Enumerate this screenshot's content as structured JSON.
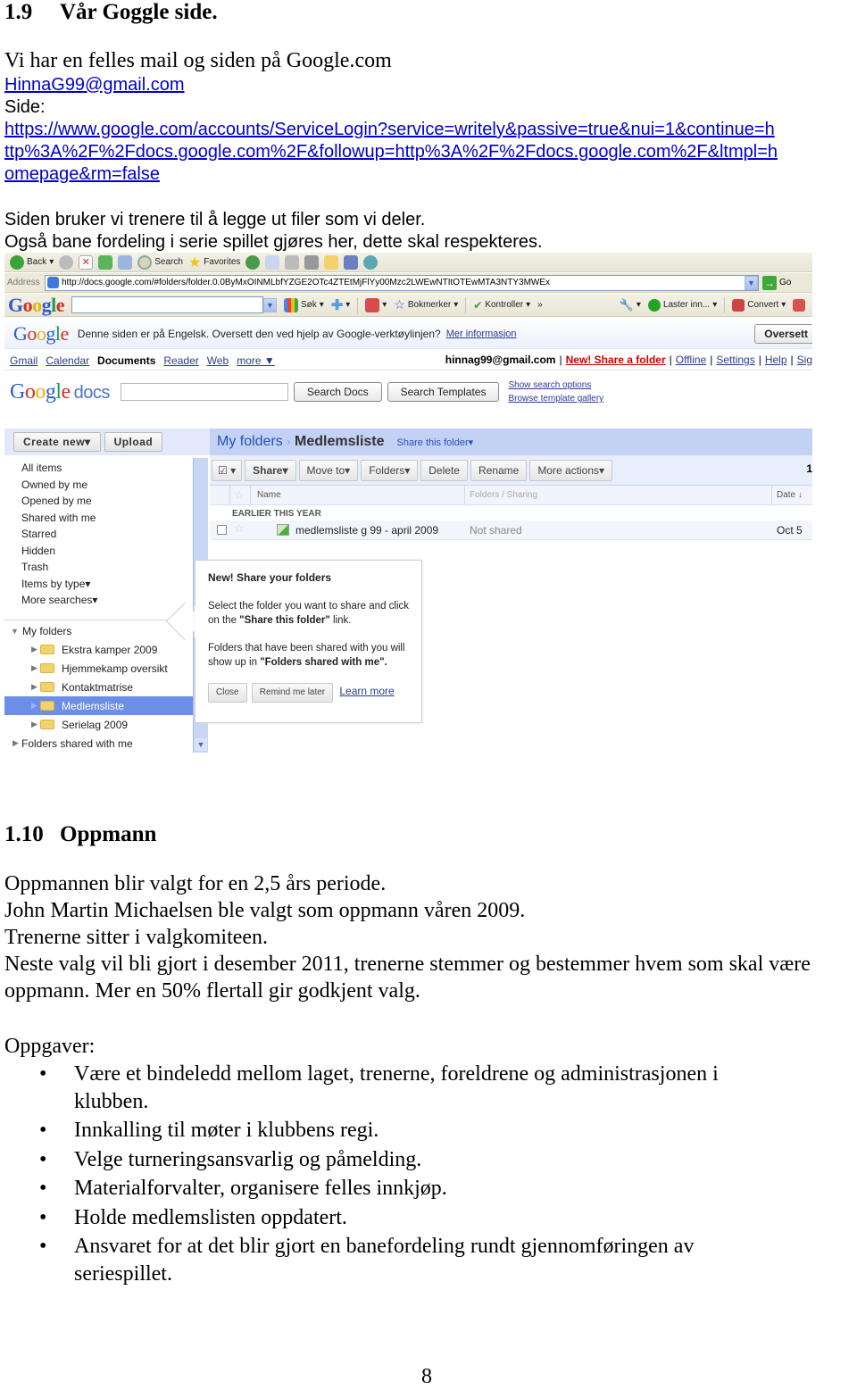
{
  "section_1_9": {
    "number": "1.9",
    "title": "Vår Goggle side.",
    "intro": "Vi har en felles mail og siden på Google.com",
    "email_link": "HinnaG99@gmail.com",
    "side_label": "Side:",
    "url_lines": [
      "https://www.google.com/accounts/ServiceLogin?service=writely&passive=true&nui=1&continue=h",
      "ttp%3A%2F%2Fdocs.google.com%2F&followup=http%3A%2F%2Fdocs.google.com%2F&ltmpl=h",
      "omepage&rm=false"
    ],
    "usage_lines": [
      "Siden bruker vi trenere til å legge ut filer som vi deler.",
      "Også bane fordeling i serie spillet gjøres her, dette skal respekteres."
    ]
  },
  "screenshot": {
    "ie_toolbar": {
      "back": "Back",
      "search": "Search",
      "favorites": "Favorites"
    },
    "address_bar": {
      "label": "Address",
      "url": "http://docs.google.com/#folders/folder.0.0ByMxOINMLbfYZGE2OTc4ZTEtMjFlYy00Mzc2LWEwNTItOTEwMTA3NTY3MWEx",
      "go": "Go"
    },
    "google_toolbar": {
      "logo": "Google",
      "search_value": "",
      "sok": "Søk",
      "bokmerker": "Bokmerker",
      "kontroller": "Kontroller",
      "more": "»",
      "loading": "Laster inn...",
      "convert": "Convert"
    },
    "translate_bar": {
      "logo": "Google",
      "message": "Denne siden er på Engelsk. Oversett den ved hjelp av Google-verktøylinjen?",
      "more_info": "Mer informasjon",
      "button": "Oversett"
    },
    "nav": {
      "items": [
        "Gmail",
        "Calendar",
        "Documents",
        "Reader",
        "Web",
        "more ▼"
      ],
      "user": "hinnag99@gmail.com",
      "share_folder": "New! Share a folder",
      "offline": "Offline",
      "settings": "Settings",
      "help": "Help",
      "sign_out": "Sig"
    },
    "docs_header": {
      "logo": "Google",
      "logo_suffix": "docs",
      "search_value": "",
      "search_docs": "Search Docs",
      "search_templates": "Search Templates",
      "show_search_options": "Show search options",
      "browse_gallery": "Browse template gallery"
    },
    "sidebar": {
      "create_new": "Create new▾",
      "upload": "Upload",
      "filters": [
        "All items",
        "Owned by me",
        "Opened by me",
        "Shared with me",
        "Starred",
        "Hidden",
        "Trash",
        "Items by type▾",
        "More searches▾"
      ],
      "my_folders": "My folders",
      "folders": [
        "Ekstra kamper 2009",
        "Hjemmekamp oversikt",
        "Kontaktmatrise",
        "Medlemsliste",
        "Serielag 2009"
      ],
      "selected_folder": "Medlemsliste",
      "shared_with_me": "Folders shared with me"
    },
    "main": {
      "breadcrumb_root": "My folders",
      "breadcrumb_sep": "›",
      "breadcrumb_current": "Medlemsliste",
      "share_this_folder": "Share this folder▾",
      "toolbar": [
        "Share▾",
        "Move to▾",
        "Folders▾",
        "Delete",
        "Rename",
        "More actions▾"
      ],
      "count": "1",
      "columns": {
        "name": "Name",
        "folders_sharing": "Folders / Sharing",
        "date": "Date ↓"
      },
      "group": "EARLIER THIS YEAR",
      "rows": [
        {
          "name": "medlemsliste g 99 - april 2009",
          "sharing": "Not shared",
          "date": "Oct 5"
        }
      ]
    },
    "popup": {
      "title": "New! Share your folders",
      "p1_a": "Select the folder you want to share and click on the ",
      "p1_b": "\"Share this folder\"",
      "p1_c": " link.",
      "p2_a": "Folders that have been shared with you will show up in ",
      "p2_b": "\"Folders shared with me\".",
      "close": "Close",
      "remind": "Remind me later",
      "learn_more": "Learn more"
    }
  },
  "section_1_10": {
    "number": "1.10",
    "title": "Oppmann",
    "paragraphs": [
      "Oppmannen blir valgt for en 2,5 års periode.",
      "John Martin Michaelsen ble valgt som oppmann våren 2009.",
      "Trenerne sitter i valgkomiteen.",
      "Neste valg vil bli gjort i desember 2011, trenerne stemmer og bestemmer hvem som skal være oppmann. Mer en 50% flertall gir godkjent valg."
    ],
    "tasks_label": "Oppgaver:",
    "tasks": [
      "Være et bindeledd mellom laget, trenerne, foreldrene og administrasjonen i klubben.",
      "Innkalling til møter i klubbens regi.",
      "Velge turneringsansvarlig og påmelding.",
      "Materialforvalter, organisere felles innkjøp.",
      "Holde medlemslisten oppdatert.",
      "Ansvaret for at det blir gjort en banefordeling rundt gjennomføringen av seriespillet."
    ]
  },
  "page_number": "8"
}
